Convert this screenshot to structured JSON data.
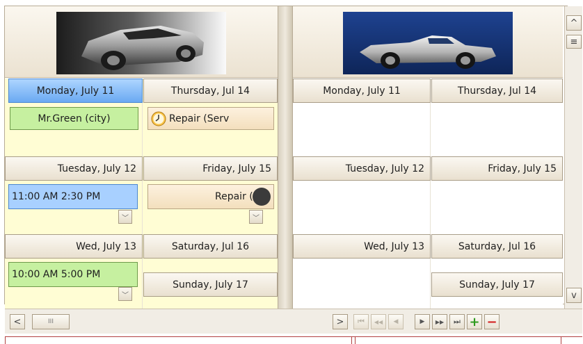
{
  "resources": [
    {
      "image_icon": "silver-coupe-car-icon"
    },
    {
      "image_icon": "silver-convertible-car-icon"
    }
  ],
  "left_group": {
    "days": [
      {
        "label": "Monday, July 11",
        "selected": true
      },
      {
        "label": "Thursday, Jul 14"
      },
      {
        "label": "Tuesday, July 12"
      },
      {
        "label": "Friday, July 15"
      },
      {
        "label": "Wed, July 13"
      },
      {
        "label": "Saturday, Jul 16"
      },
      {
        "label": "Sunday, July 17"
      }
    ],
    "appointments": {
      "mon": "Mr.Green (city)",
      "thu": "Repair (Serv",
      "tue": "11:00 AM 2:30 PM",
      "fri": "Repair (Ser",
      "wed": "10:00 AM 5:00 PM"
    }
  },
  "right_group": {
    "days": [
      {
        "label": "Monday, July 11"
      },
      {
        "label": "Thursday, Jul 14"
      },
      {
        "label": "Tuesday, July 12"
      },
      {
        "label": "Friday, July 15"
      },
      {
        "label": "Wed, July 13"
      },
      {
        "label": "Saturday, Jul 16"
      },
      {
        "label": "Sunday, July 17"
      }
    ]
  },
  "scroll": {
    "left_arrow": "<",
    "right_arrow": ">",
    "thumb": "III",
    "up": "^",
    "down": "v",
    "thumb_v": "≡"
  },
  "navigator": {
    "first": "⏮",
    "prev_page": "◀◀",
    "prev": "◀",
    "next": "▶",
    "next_page": "▶▶",
    "last": "⏭",
    "add": "+",
    "remove": "−"
  },
  "colors": {
    "selected_header": "#6aa9f2",
    "work_cell": "#fffdd4",
    "add_green": "#2e9a1e",
    "remove_red": "#d21e1e"
  }
}
